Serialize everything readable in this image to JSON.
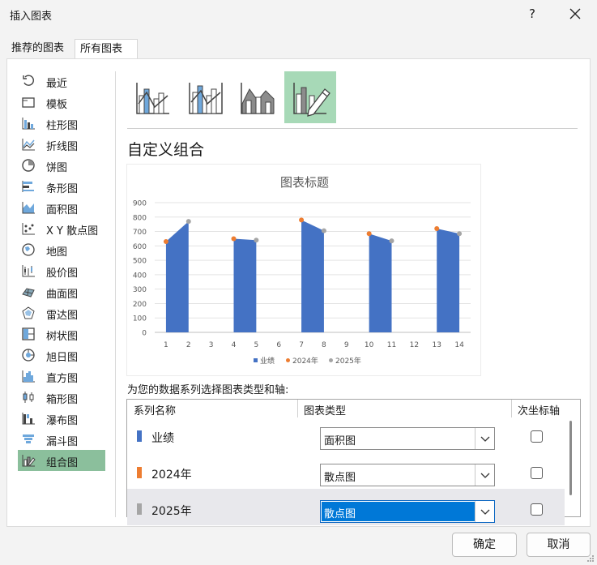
{
  "window": {
    "title": "插入图表",
    "help": "?"
  },
  "tabs": [
    {
      "label": "推荐的图表"
    },
    {
      "label": "所有图表"
    }
  ],
  "sidebar": {
    "items": [
      {
        "label": "最近",
        "icon": "recent-icon"
      },
      {
        "label": "模板",
        "icon": "template-icon"
      },
      {
        "label": "柱形图",
        "icon": "column-chart-icon"
      },
      {
        "label": "折线图",
        "icon": "line-chart-icon"
      },
      {
        "label": "饼图",
        "icon": "pie-chart-icon"
      },
      {
        "label": "条形图",
        "icon": "bar-chart-icon"
      },
      {
        "label": "面积图",
        "icon": "area-chart-icon"
      },
      {
        "label": "X Y 散点图",
        "icon": "scatter-chart-icon"
      },
      {
        "label": "地图",
        "icon": "map-chart-icon"
      },
      {
        "label": "股价图",
        "icon": "stock-chart-icon"
      },
      {
        "label": "曲面图",
        "icon": "surface-chart-icon"
      },
      {
        "label": "雷达图",
        "icon": "radar-chart-icon"
      },
      {
        "label": "树状图",
        "icon": "treemap-chart-icon"
      },
      {
        "label": "旭日图",
        "icon": "sunburst-chart-icon"
      },
      {
        "label": "直方图",
        "icon": "histogram-chart-icon"
      },
      {
        "label": "箱形图",
        "icon": "box-whisker-chart-icon"
      },
      {
        "label": "瀑布图",
        "icon": "waterfall-chart-icon"
      },
      {
        "label": "漏斗图",
        "icon": "funnel-chart-icon"
      },
      {
        "label": "组合图",
        "icon": "combo-chart-icon"
      }
    ],
    "active_index": 18
  },
  "subtypes": [
    {
      "icon": "clustered-column-line-icon"
    },
    {
      "icon": "clustered-column-line-secondary-icon"
    },
    {
      "icon": "stacked-area-column-icon"
    },
    {
      "icon": "custom-combination-icon"
    }
  ],
  "section_title": "自定义组合",
  "chart_data": {
    "type": "area",
    "title": "图表标题",
    "categories": [
      "1",
      "2",
      "3",
      "4",
      "5",
      "6",
      "7",
      "8",
      "9",
      "10",
      "11",
      "12",
      "13",
      "14"
    ],
    "ylim": [
      0,
      900
    ],
    "yticks": [
      "0",
      "100",
      "200",
      "300",
      "400",
      "500",
      "600",
      "700",
      "800",
      "900"
    ],
    "grid": true,
    "legend_position": "bottom",
    "series": [
      {
        "name": "业绩",
        "chart": "area",
        "color": "#4472c4",
        "values": [
          630,
          770,
          null,
          650,
          640,
          null,
          780,
          705,
          null,
          685,
          635,
          null,
          720,
          685
        ]
      },
      {
        "name": "2024年",
        "chart": "scatter",
        "color": "#ed7d31",
        "points": [
          [
            1,
            630
          ],
          [
            4,
            650
          ],
          [
            7,
            780
          ],
          [
            10,
            685
          ],
          [
            13,
            720
          ]
        ]
      },
      {
        "name": "2025年",
        "chart": "scatter",
        "color": "#a5a5a5",
        "points": [
          [
            2,
            770
          ],
          [
            5,
            640
          ],
          [
            8,
            705
          ],
          [
            11,
            635
          ],
          [
            14,
            685
          ]
        ]
      }
    ]
  },
  "series_config": {
    "instruction": "为您的数据系列选择图表类型和轴:",
    "headers": {
      "name": "系列名称",
      "type": "图表类型",
      "secondary": "次坐标轴"
    },
    "rows": [
      {
        "name": "业绩",
        "color": "#4472c4",
        "chart_type": "面积图",
        "secondary": false,
        "selected": false
      },
      {
        "name": "2024年",
        "color": "#ed7d31",
        "chart_type": "散点图",
        "secondary": false,
        "selected": false
      },
      {
        "name": "2025年",
        "color": "#a5a5a5",
        "chart_type": "散点图",
        "secondary": false,
        "selected": true
      }
    ]
  },
  "buttons": {
    "ok": "确定",
    "cancel": "取消"
  }
}
